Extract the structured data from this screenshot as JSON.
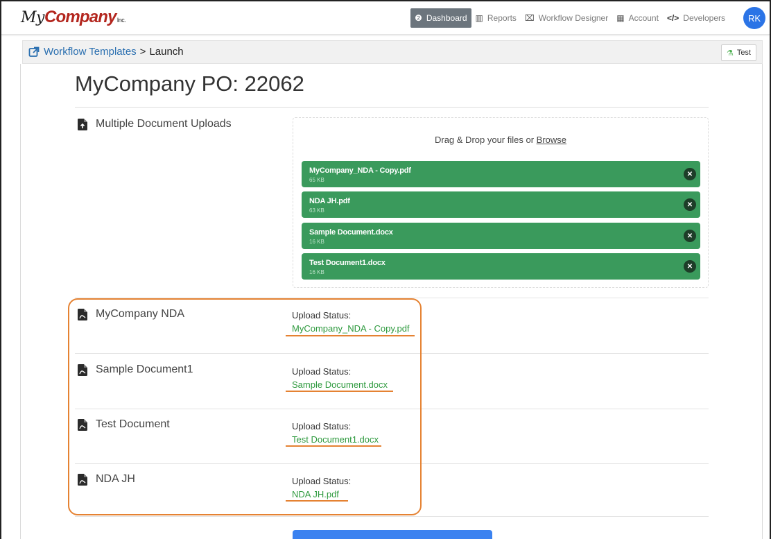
{
  "app": {
    "logo_my": "My",
    "logo_company": "Company",
    "logo_inc": "Inc."
  },
  "nav": {
    "items": [
      {
        "label": "Dashboard",
        "icon": "dashboard-icon",
        "glyph": "❷",
        "active": true
      },
      {
        "label": "Reports",
        "icon": "chart-icon",
        "glyph": "▥",
        "active": false
      },
      {
        "label": "Workflow Designer",
        "icon": "workflow-icon",
        "glyph": "⌧",
        "active": false
      },
      {
        "label": "Account",
        "icon": "building-icon",
        "glyph": "▦",
        "active": false
      },
      {
        "label": "Developers",
        "icon": "code-icon",
        "glyph": "</>",
        "active": false
      }
    ],
    "avatar_initials": "RK"
  },
  "breadcrumb": {
    "link": "Workflow Templates",
    "separator": ">",
    "current": "Launch",
    "test_button": "Test"
  },
  "page": {
    "title": "MyCompany PO: 22062"
  },
  "uploads": {
    "label": "Multiple Document Uploads",
    "drop_text": "Drag & Drop your files or ",
    "browse_text": "Browse",
    "files": [
      {
        "name": "MyCompany_NDA - Copy.pdf",
        "size": "65 KB"
      },
      {
        "name": "NDA JH.pdf",
        "size": "63 KB"
      },
      {
        "name": "Sample Document.docx",
        "size": "16 KB"
      },
      {
        "name": "Test Document1.docx",
        "size": "16 KB"
      }
    ]
  },
  "documents": [
    {
      "label": "MyCompany NDA",
      "status_label": "Upload Status:",
      "status_value": "MyCompany_NDA - Copy.pdf"
    },
    {
      "label": "Sample Document1",
      "status_label": "Upload Status:",
      "status_value": "Sample Document.docx"
    },
    {
      "label": "Test Document",
      "status_label": "Upload Status:",
      "status_value": "Test Document1.docx"
    },
    {
      "label": "NDA JH",
      "status_label": "Upload Status:",
      "status_value": "NDA JH.pdf"
    }
  ],
  "colors": {
    "accent_blue": "#2a6fb0",
    "file_green": "#3a9a5c",
    "status_green": "#2e9a3e",
    "highlight_orange": "#e58232",
    "logo_red": "#b3261e"
  }
}
